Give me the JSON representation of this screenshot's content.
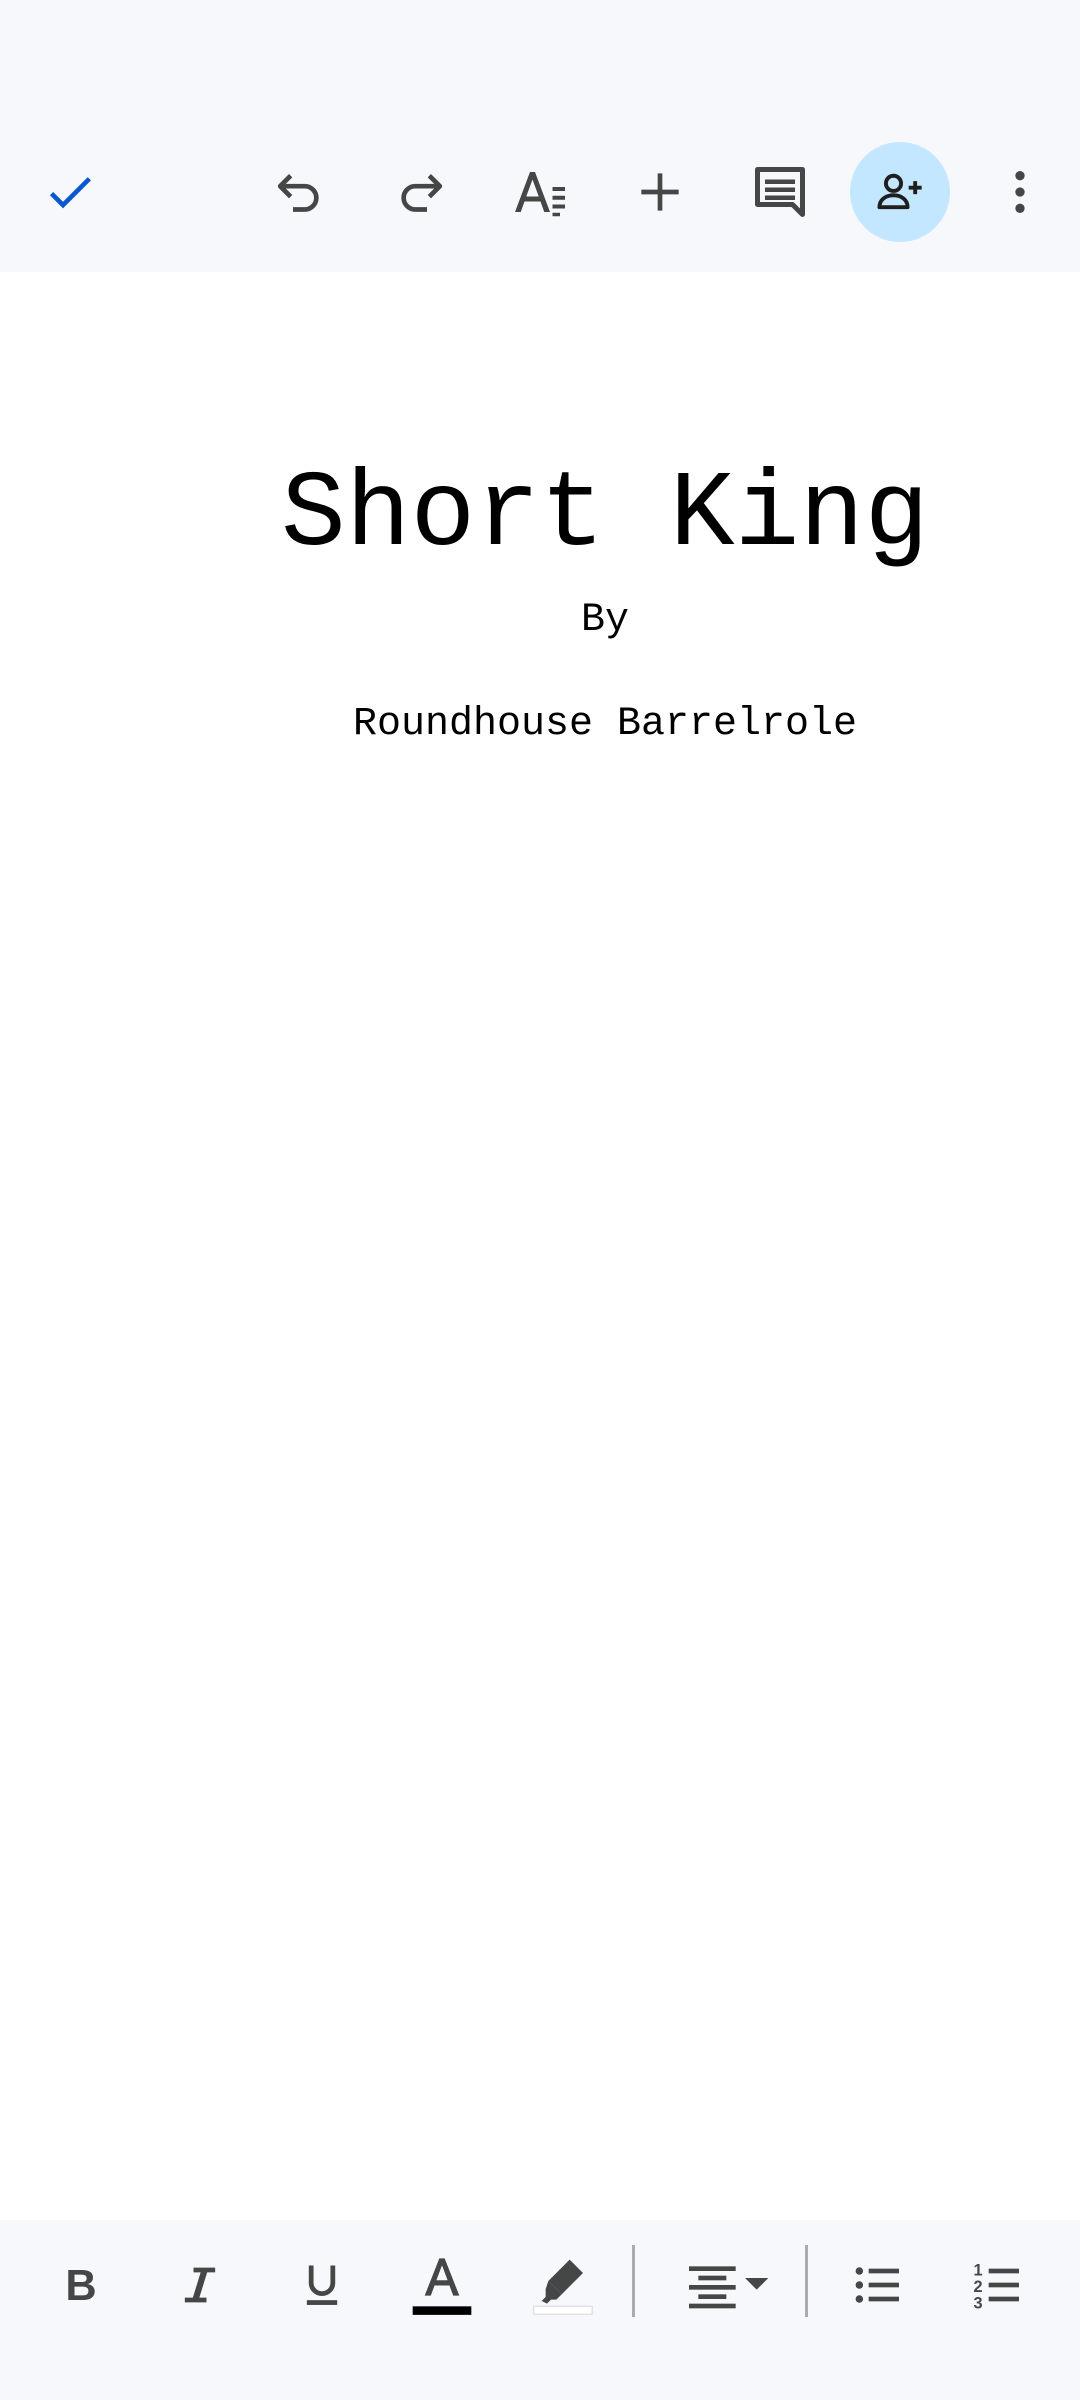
{
  "document": {
    "title": "Short King",
    "by_line": "By",
    "author": "Roundhouse Barrelrole"
  },
  "toolbar": {
    "icons": [
      "check-icon",
      "undo-icon",
      "redo-icon",
      "text-format-icon",
      "insert-icon",
      "comment-icon",
      "share-person-add-icon",
      "more-vert-icon"
    ]
  },
  "format_bar": {
    "icons": [
      "bold-icon",
      "italic-icon",
      "underline-icon",
      "text-color-icon",
      "highlight-icon",
      "align-center-icon",
      "bulleted-list-icon",
      "numbered-list-icon"
    ],
    "text_color": "#000000",
    "highlight_color": "#ffffff"
  },
  "colors": {
    "accent": "#0b57d0",
    "bar_bg": "#f7f8fc",
    "share_bg": "#c2e7ff",
    "icon": "#444746"
  }
}
